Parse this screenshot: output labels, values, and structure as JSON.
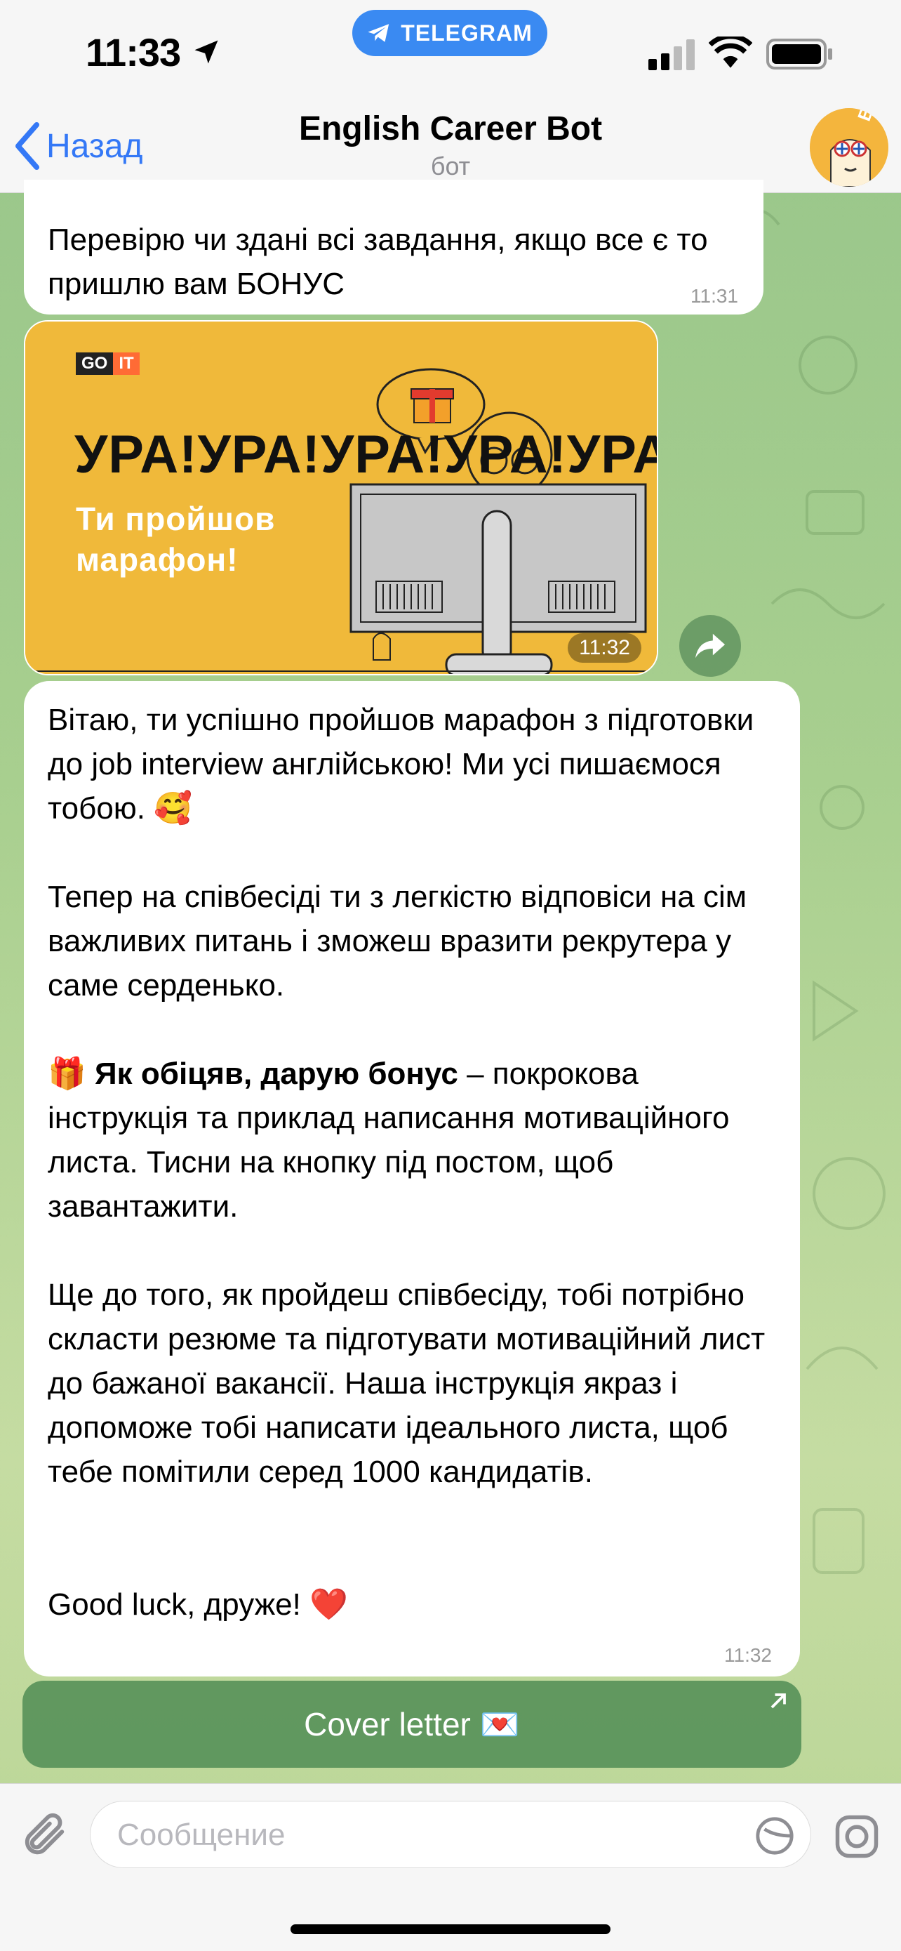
{
  "status_bar": {
    "time": "11:33",
    "app_pill": "TELEGRAM",
    "icons": [
      "location-arrow-icon",
      "cellular-signal-icon",
      "wifi-icon",
      "battery-icon"
    ]
  },
  "header": {
    "back_label": "Назад",
    "title": "English Career Bot",
    "subtitle": "бот",
    "avatar_text": "BOT"
  },
  "messages": [
    {
      "type": "text",
      "text": "Перевірю чи здані всі завдання, якщо все є то пришлю вам БОНУС",
      "time": "11:31"
    },
    {
      "type": "image",
      "time": "11:32",
      "image": {
        "logo_go": "GO",
        "logo_it": "IT",
        "headline": "УРА!УРА!УРА!УРА!УРА!",
        "line1": "Ти пройшов",
        "line2": "марафон!"
      }
    },
    {
      "type": "text",
      "time": "11:32",
      "p1": "Вітаю, ти успішно пройшов марафон з підготовки до job interview англійською! Ми усі пишаємося тобою. 🥰",
      "p2": "Тепер на співбесіді ти з легкістю відповіси на сім важливих питань і зможеш вразити рекрутера у саме серденько.",
      "p3_emoji": "🎁",
      "p3_bold": "Як обіцяв, дарую бонус",
      "p3_rest": " – покрокова інструкція та приклад написання мотиваційного листа. Тисни на кнопку під постом, щоб завантажити.",
      "p4": "Ще до того, як пройдеш співбесіду, тобі потрібно скласти резюме та підготувати мотиваційний лист до бажаної вакансії. Наша інструкція якраз і допоможе тобі написати ідеального листа, щоб тебе помітили серед 1000 кандидатів.",
      "p5": "Good luck, друже! ❤️"
    }
  ],
  "inline_button": {
    "label": "Cover letter 💌"
  },
  "composer": {
    "placeholder": "Сообщение",
    "value": ""
  },
  "colors": {
    "accent": "#3478f6",
    "telegram_pill": "#3a8af2",
    "button_green": "#4c8a52",
    "image_bg": "#f0b93a"
  }
}
